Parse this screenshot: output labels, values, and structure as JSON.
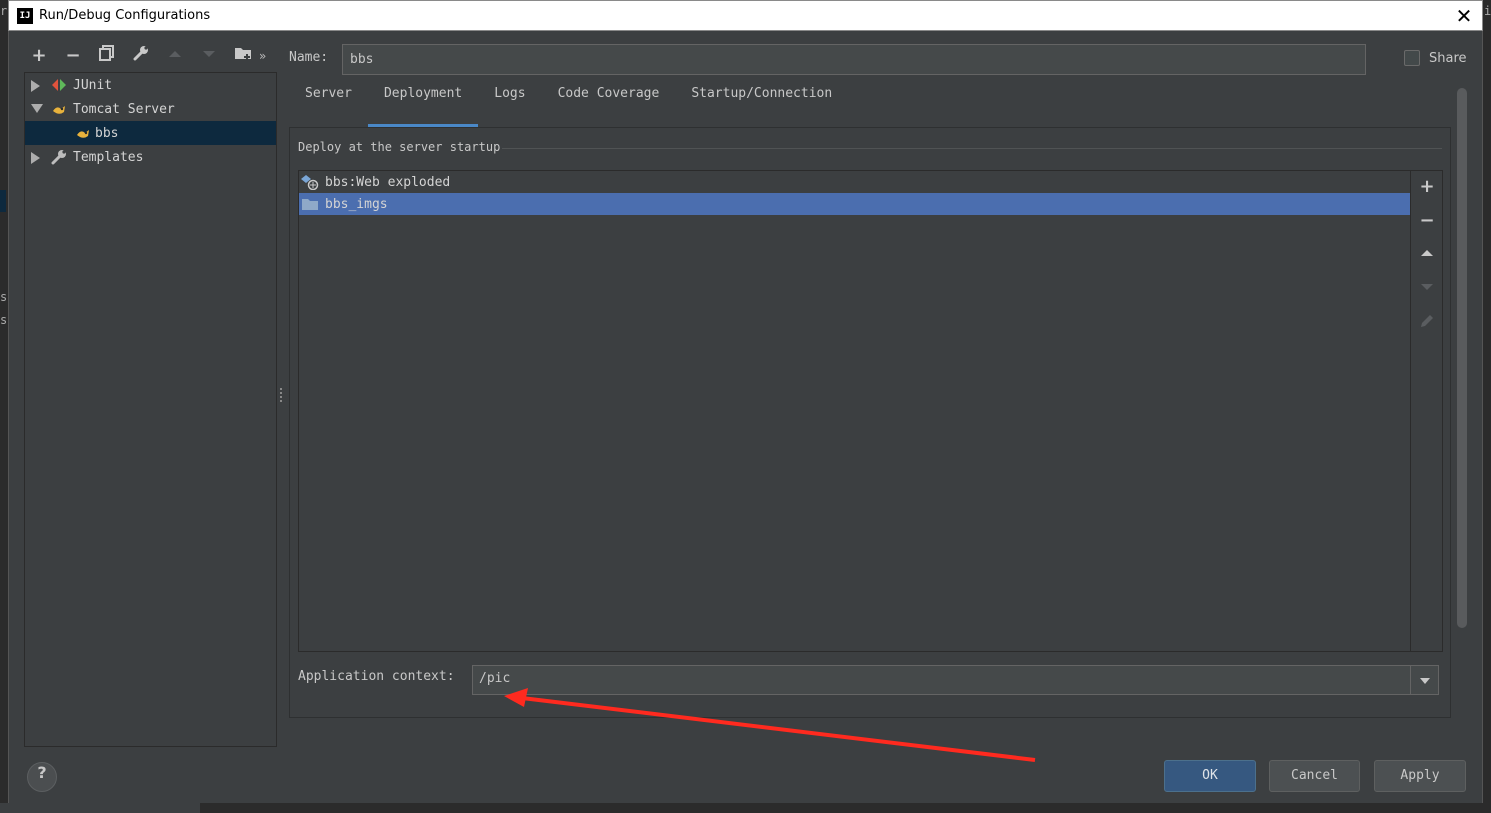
{
  "window": {
    "title": "Run/Debug Configurations",
    "app_icon_text": "IJ",
    "close_glyph": "✕"
  },
  "toolbar": {
    "add": "+",
    "remove": "−",
    "more": "»"
  },
  "tree": {
    "items": [
      {
        "label": "JUnit",
        "expanded": false
      },
      {
        "label": "Tomcat Server",
        "expanded": true
      },
      {
        "label": "bbs",
        "child": true,
        "selected": true
      },
      {
        "label": "Templates",
        "expanded": false
      }
    ]
  },
  "config": {
    "name_label": "Name:",
    "name_value": "bbs",
    "share_label": "Share",
    "share_checked": false
  },
  "tabs": [
    {
      "label": "Server",
      "active": false
    },
    {
      "label": "Deployment",
      "active": true
    },
    {
      "label": "Logs",
      "active": false
    },
    {
      "label": "Code Coverage",
      "active": false
    },
    {
      "label": "Startup/Connection",
      "active": false
    }
  ],
  "deployment": {
    "section_title": "Deploy at the server startup",
    "items": [
      {
        "label": "bbs:Web exploded",
        "icon": "artifact-icon",
        "selected": false
      },
      {
        "label": "bbs_imgs",
        "icon": "folder-icon",
        "selected": true
      }
    ],
    "side_tools": {
      "add": "+",
      "remove": "−"
    },
    "context_label": "Application context:",
    "context_value": "/pic"
  },
  "buttons": {
    "help": "?",
    "ok": "OK",
    "cancel": "Cancel",
    "apply": "Apply"
  },
  "edge": {
    "left_text_1": "r",
    "left_text_2": "s",
    "left_text_3": "s",
    "right_text": "i"
  },
  "colors": {
    "background": "#3c3f41",
    "selection": "#4b6eaf",
    "tab_underline": "#4a88c7",
    "ok_button": "#365880",
    "annotation_arrow": "#ff2a1f"
  }
}
